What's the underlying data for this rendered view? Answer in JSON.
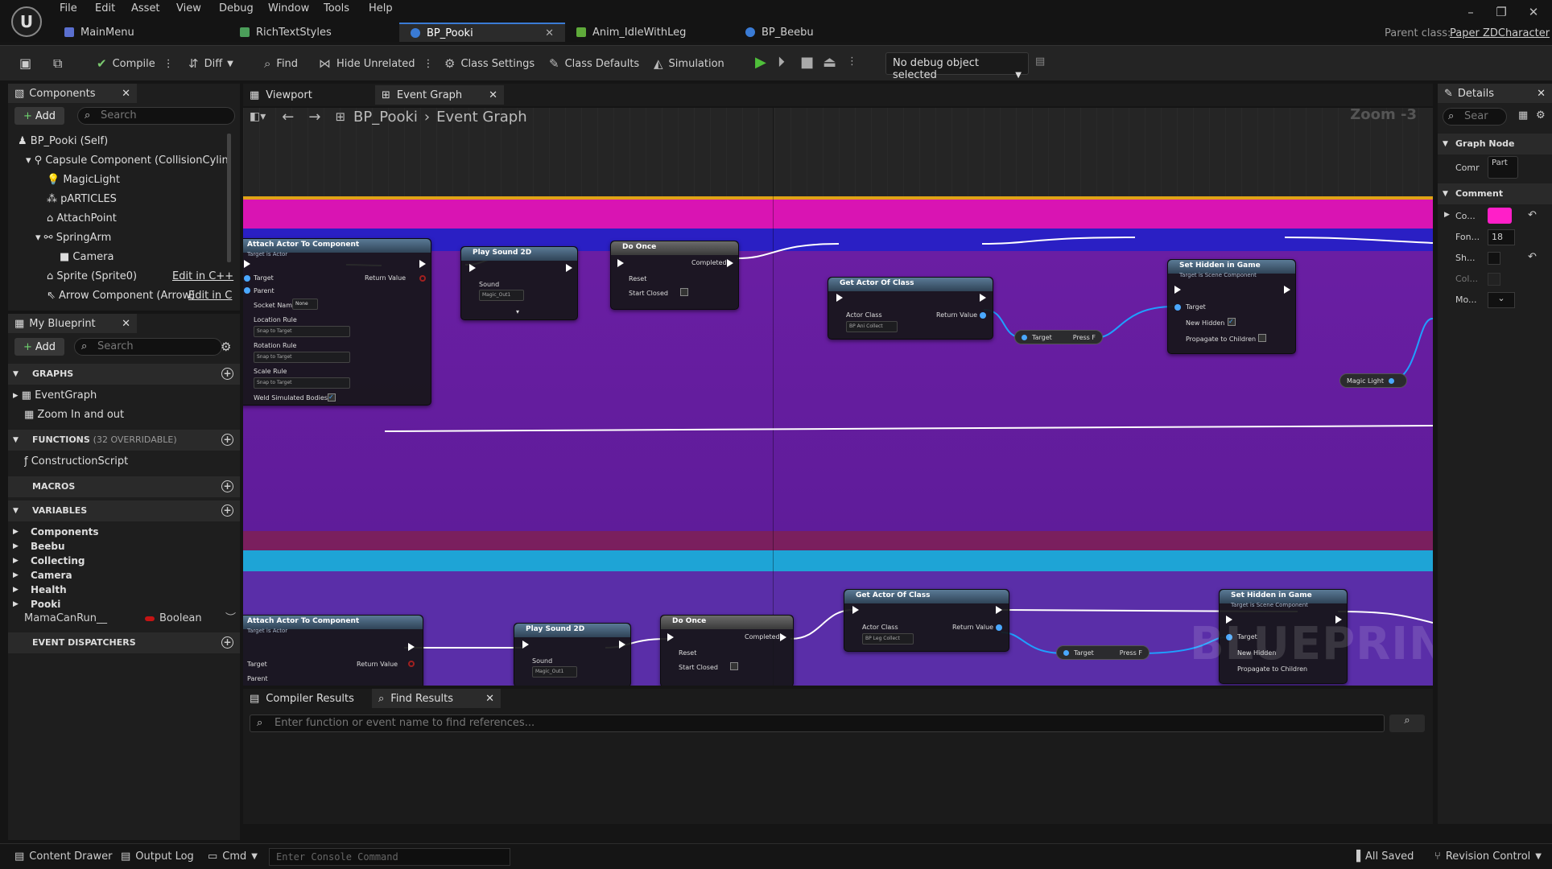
{
  "menu": [
    "File",
    "Edit",
    "Asset",
    "View",
    "Debug",
    "Window",
    "Tools",
    "Help"
  ],
  "tabs": [
    "MainMenu",
    "RichTextStyles",
    "BP_Pooki",
    "Anim_IdleWithLeg",
    "BP_Beebu"
  ],
  "parent_class_label": "Parent class:",
  "parent_class_value": "Paper ZDCharacter",
  "toolbar": {
    "compile": "Compile",
    "diff": "Diff",
    "find": "Find",
    "hide_unrelated": "Hide Unrelated",
    "class_settings": "Class Settings",
    "class_defaults": "Class Defaults",
    "simulation": "Simulation",
    "debug_select": "No debug object selected"
  },
  "components": {
    "title": "Components",
    "add": "Add",
    "search_placeholder": "Search",
    "items": [
      "BP_Pooki (Self)",
      "Capsule Component (CollisionCylinde",
      "MagicLight",
      "pARTICLES",
      "AttachPoint",
      "SpringArm",
      "Camera",
      "Sprite (Sprite0)",
      "Arrow Component (Arrow)"
    ],
    "edit_cpp": "Edit in C++",
    "edit_c": "Edit in C"
  },
  "my_blueprint": {
    "title": "My Blueprint",
    "add": "Add",
    "search_placeholder": "Search",
    "graphs": "GRAPHS",
    "graph_items": [
      "EventGraph",
      "Zoom In and out"
    ],
    "functions": "FUNCTIONS",
    "functions_count": "(32 OVERRIDABLE)",
    "function_items": [
      "ConstructionScript"
    ],
    "macros": "MACROS",
    "variables": "VARIABLES",
    "var_cats": [
      "Components",
      "Beebu",
      "Collecting",
      "Camera",
      "Health",
      "Pooki"
    ],
    "var_name": "MamaCanRun__",
    "var_type": "Boolean",
    "event_dispatchers": "EVENT DISPATCHERS"
  },
  "center_tabs": [
    "Viewport",
    "Event Graph"
  ],
  "breadcrumb": {
    "root": "BP_Pooki",
    "leaf": "Event Graph"
  },
  "zoom": "Zoom -3",
  "watermark": "BLUEPRINT",
  "nodes": {
    "attach": "Attach Actor To Component",
    "attach_sub": "Target is Actor",
    "target": "Target",
    "parent": "Parent",
    "socket": "Socket Name",
    "none": "None",
    "return_value": "Return Value",
    "loc_rule": "Location Rule",
    "rot_rule": "Rotation Rule",
    "scale_rule": "Scale Rule",
    "snap": "Snap to Target",
    "weld": "Weld Simulated Bodies",
    "play": "Play Sound 2D",
    "sound": "Sound",
    "sound_val": "Magic_Out1",
    "do_once": "Do Once",
    "completed": "Completed",
    "reset": "Reset",
    "start_closed": "Start Closed",
    "get_actor": "Get Actor Of Class",
    "actor_class": "Actor Class",
    "class_val1": "BP Ani Collect",
    "class_val2": "BP Leg Collect",
    "set_hidden": "Set Hidden in Game",
    "set_hidden_sub": "Target is Scene Component",
    "new_hidden": "New Hidden",
    "propagate": "Propagate to Children",
    "press_f": "Press F",
    "magic_light": "Magic Light"
  },
  "bottom": {
    "tabs": [
      "Compiler Results",
      "Find Results"
    ],
    "placeholder": "Enter function or event name to find references..."
  },
  "details": {
    "title": "Details",
    "search_placeholder": "Sear",
    "graph_node": "Graph Node",
    "comment_label": "Comr",
    "comment_val": "Part",
    "comment_section": "Comment",
    "rows": [
      "Co...",
      "Fon...",
      "Sh...",
      "Col...",
      "Mo..."
    ],
    "font_size": "18",
    "color": "#ff1fc8"
  },
  "status": {
    "content_drawer": "Content Drawer",
    "output_log": "Output Log",
    "cmd": "Cmd",
    "console_placeholder": "Enter Console Command",
    "all_saved": "All Saved",
    "revision_control": "Revision Control"
  }
}
